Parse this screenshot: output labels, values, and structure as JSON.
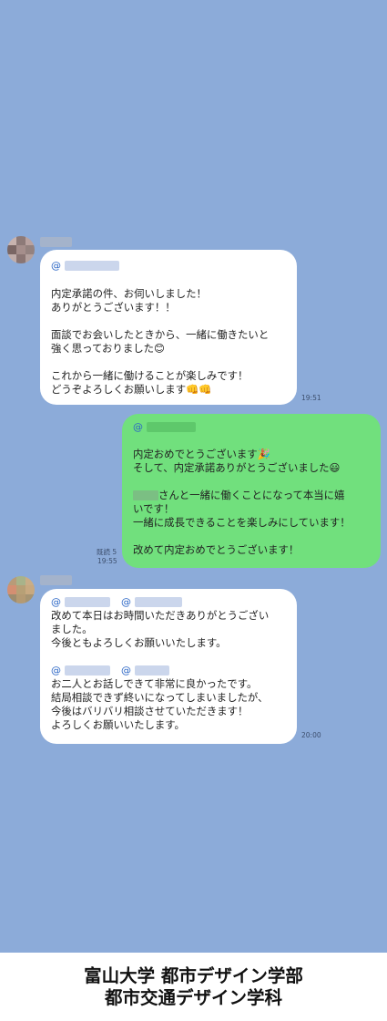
{
  "messages": [
    {
      "mention": "@",
      "body": "内定承諾の件、お伺いしました！\nありがとうございます！！\n\n面談でお会いしたときから、一緒に働きたいと\n強く思っておりました",
      "emoji1": "😊",
      "body2": "\n\nこれから一緒に働けることが楽しみです！\nどうぞよろしくお願いします",
      "emoji2": "👊👊",
      "time": "19:51"
    },
    {
      "mention": "@",
      "line1": "内定おめでとうございます",
      "emoji1": "🎉",
      "line2": "そして、内定承諾ありがとうございました",
      "emoji2": "😃",
      "line3_suffix": "さんと一緒に働くことになって本当に嬉",
      "body": "いです！\n一緒に成長できることを楽しみにしています！\n\n改めて内定おめでとうございます！",
      "read": "既読 5",
      "time": "19:55"
    },
    {
      "mention_a": "@",
      "mention_b": "@",
      "body": "改めて本日はお時間いただきありがとうござい\nました。\n今後ともよろしくお願いいたします。",
      "mention_c": "@",
      "mention_d": "@",
      "body2": "お二人とお話しできて非常に良かったです。\n結局相談できず終いになってしまいましたが、\n今後はバリバリ相談させていただきます！\nよろしくお願いいたします。",
      "time": "20:00"
    }
  ],
  "footer": {
    "line1": "富山大学 都市デザイン学部",
    "line2": "都市交通デザイン学科"
  },
  "colors": {
    "background": "#8cabd9",
    "incoming": "#ffffff",
    "outgoing": "#71e07d"
  }
}
